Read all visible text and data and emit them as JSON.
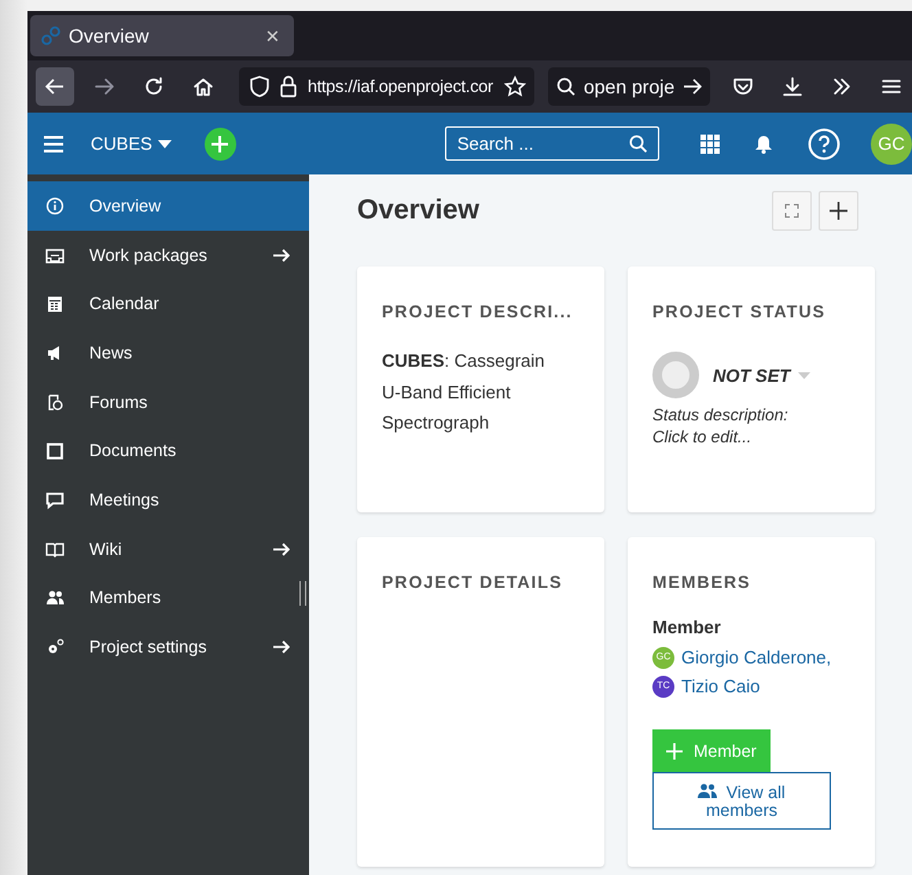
{
  "browser": {
    "tabs": [
      {
        "title": "Overview",
        "selected": true,
        "close": "✕"
      }
    ],
    "url": "https://iaf.openproject.cor",
    "search": "open proje"
  },
  "header": {
    "project": "CUBES",
    "search": {
      "placeholder": "Search ..."
    },
    "avatar": "GC"
  },
  "sidebar": {
    "items": [
      {
        "label": "Overview",
        "selected": true,
        "arrow": false
      },
      {
        "label": "Work packages",
        "selected": false,
        "arrow": true
      },
      {
        "label": "Calendar",
        "selected": false,
        "arrow": false
      },
      {
        "label": "News",
        "selected": false,
        "arrow": false
      },
      {
        "label": "Forums",
        "selected": false,
        "arrow": false
      },
      {
        "label": "Documents",
        "selected": false,
        "arrow": false
      },
      {
        "label": "Meetings",
        "selected": false,
        "arrow": false
      },
      {
        "label": "Wiki",
        "selected": false,
        "arrow": true
      },
      {
        "label": "Members",
        "selected": false,
        "arrow": false
      },
      {
        "label": "Project settings",
        "selected": false,
        "arrow": true
      }
    ]
  },
  "page": {
    "title": "Overview"
  },
  "widgets": [
    {
      "kind": "description",
      "title": "PROJECT DESCRI...",
      "text": "**CUBES**: Cassegrain U-Band Efficient Spectrograph"
    },
    {
      "kind": "status",
      "title": "PROJECT STATUS",
      "status": "NOT SET",
      "description": "Status description: Click to edit..."
    },
    {
      "kind": "details",
      "title": "PROJECT DETAILS"
    },
    {
      "kind": "members",
      "title": "MEMBERS",
      "role": "Member",
      "members": [
        {
          "initials": "GC",
          "name": "Giorgio Calderone,",
          "color": "#7cbc3c"
        },
        {
          "initials": "TC",
          "name": "Tizio Caio",
          "color": "#5a3bc4"
        }
      ],
      "add_button": "Member",
      "view_all": "View all members"
    }
  ]
}
